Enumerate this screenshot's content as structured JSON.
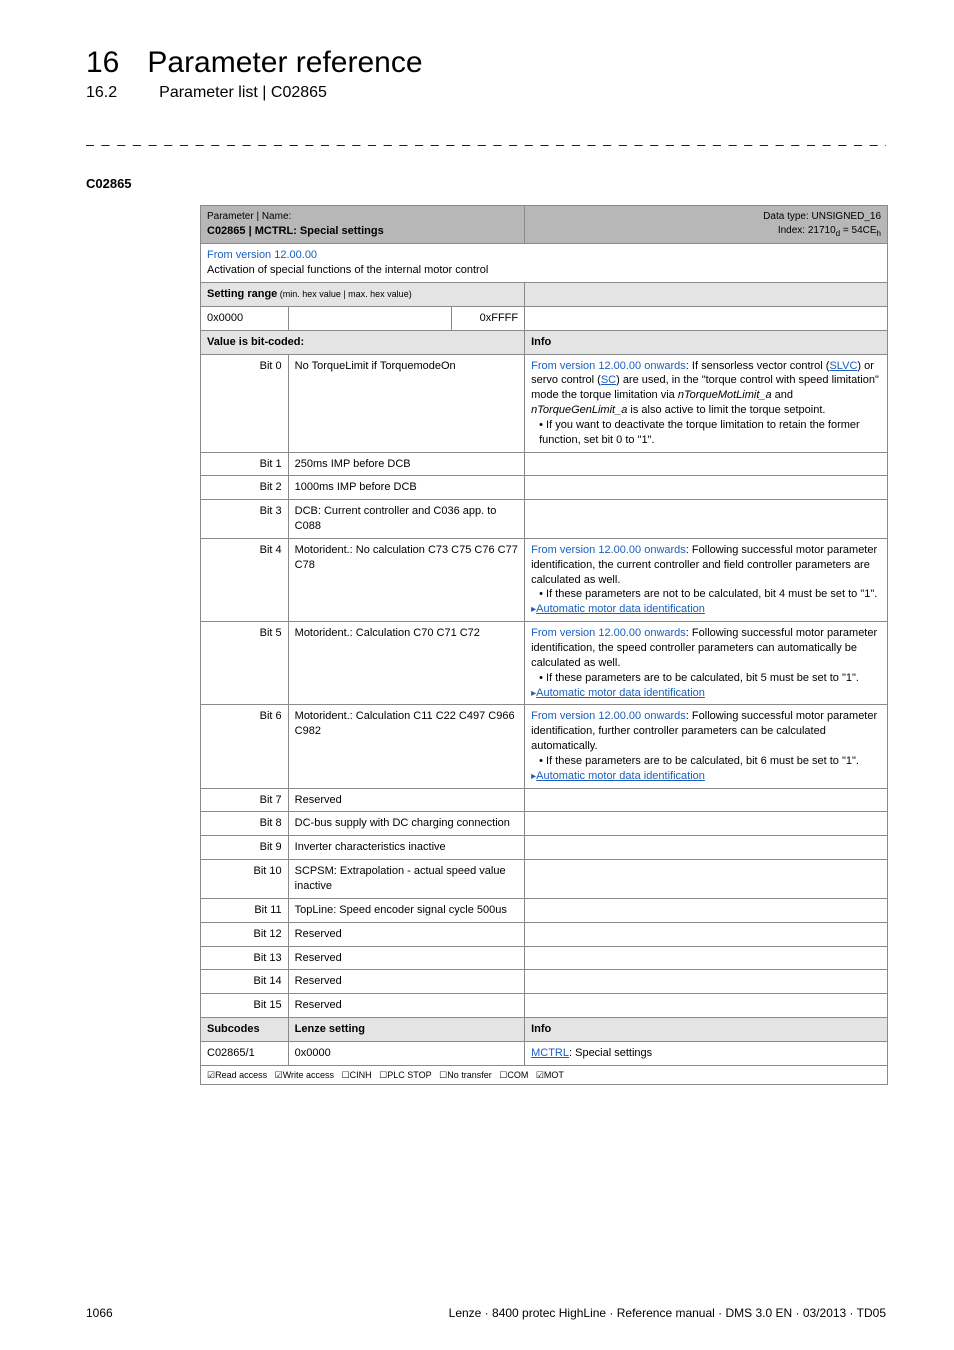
{
  "header": {
    "chapter_num": "16",
    "chapter_title": "Parameter reference",
    "section_num": "16.2",
    "section_title": "Parameter list | C02865"
  },
  "param_code_label": "C02865",
  "tbl": {
    "meta_label": "Parameter | Name:",
    "name": "C02865 | MCTRL: Special settings",
    "datatype_label": "Data type: UNSIGNED_16",
    "index_label": "Index: 21710",
    "index_sub1": "d",
    "index_eq": " = 54CE",
    "index_sub2": "h",
    "version_line": "From version 12.00.00",
    "activation_line": "Activation of special functions of the internal motor control",
    "setting_range_label": "Setting range",
    "setting_range_sub": " (min. hex value | max. hex value)",
    "range_min": "0x0000",
    "range_max": "0xFFFF",
    "value_bitcoded": "Value is bit-coded:",
    "info_label": "Info",
    "bits": [
      {
        "bit": "Bit 0",
        "name": "No TorqueLimit if TorquemodeOn",
        "info_prefix": "From version 12.00.00 onwards",
        "info_main": ": If sensorless vector control (",
        "link1": "SLVC",
        "info_mid1": ") or servo control (",
        "link2": "SC",
        "info_mid2": ") are used, in the \"torque control with speed limitation\" mode the torque limitation via ",
        "ital1": "nTorqueMotLimit_a",
        "info_mid3": " and ",
        "ital2": "nTorqueGenLimit_a",
        "info_mid4": " is also active to limit the torque setpoint.",
        "bullet": "If you want to deactivate the torque limitation to retain the former function, set bit 0 to \"1\"."
      },
      {
        "bit": "Bit 1",
        "name": "250ms IMP before DCB"
      },
      {
        "bit": "Bit 2",
        "name": "1000ms IMP before DCB"
      },
      {
        "bit": "Bit 3",
        "name": "DCB: Current controller and C036 app. to C088"
      },
      {
        "bit": "Bit 4",
        "name": "Motorident.: No calculation C73 C75 C76 C77 C78",
        "info_prefix": "From version 12.00.00 onwards",
        "info_main": ": Following successful motor parameter identification, the current controller and field controller parameters are calculated as well.",
        "bullet": "If these parameters are not to be calculated, bit 4 must be set to \"1\".",
        "link_auto": "Automatic motor data identification"
      },
      {
        "bit": "Bit 5",
        "name": "Motorident.: Calculation C70 C71 C72",
        "info_prefix": "From version 12.00.00 onwards",
        "info_main": ": Following successful motor parameter identification, the speed controller parameters can automatically be calculated as well.",
        "bullet": "If these parameters are to be calculated, bit 5 must be set to \"1\".",
        "link_auto": "Automatic motor data identification"
      },
      {
        "bit": "Bit 6",
        "name": "Motorident.: Calculation C11 C22 C497 C966 C982",
        "info_prefix": "From version 12.00.00 onwards",
        "info_main": ": Following successful motor parameter identification, further controller parameters can be calculated automatically.",
        "bullet": "If these parameters are to be calculated, bit 6 must be set to \"1\".",
        "link_auto": "Automatic motor data identification"
      },
      {
        "bit": "Bit 7",
        "name": "Reserved"
      },
      {
        "bit": "Bit 8",
        "name": "DC-bus supply with DC charging connection"
      },
      {
        "bit": "Bit 9",
        "name": "Inverter characteristics inactive"
      },
      {
        "bit": "Bit 10",
        "name": "SCPSM: Extrapolation - actual speed value inactive"
      },
      {
        "bit": "Bit 11",
        "name": "TopLine: Speed encoder signal cycle 500us"
      },
      {
        "bit": "Bit 12",
        "name": "Reserved"
      },
      {
        "bit": "Bit 13",
        "name": "Reserved"
      },
      {
        "bit": "Bit 14",
        "name": "Reserved"
      },
      {
        "bit": "Bit 15",
        "name": "Reserved"
      }
    ],
    "subcodes_label": "Subcodes",
    "lenze_label": "Lenze setting",
    "subcode_row": {
      "code": "C02865/1",
      "val": "0x0000",
      "info_link": "MCTRL",
      "info_rest": ": Special settings"
    },
    "legend": {
      "read": "Read access",
      "write": "Write access",
      "cinh": "CINH",
      "plc": "PLC STOP",
      "notr": "No transfer",
      "com": "COM",
      "mot": "MOT"
    }
  },
  "footer": {
    "page": "1066",
    "doc": "Lenze · 8400 protec HighLine · Reference manual · DMS 3.0 EN · 03/2013 · TD05"
  }
}
